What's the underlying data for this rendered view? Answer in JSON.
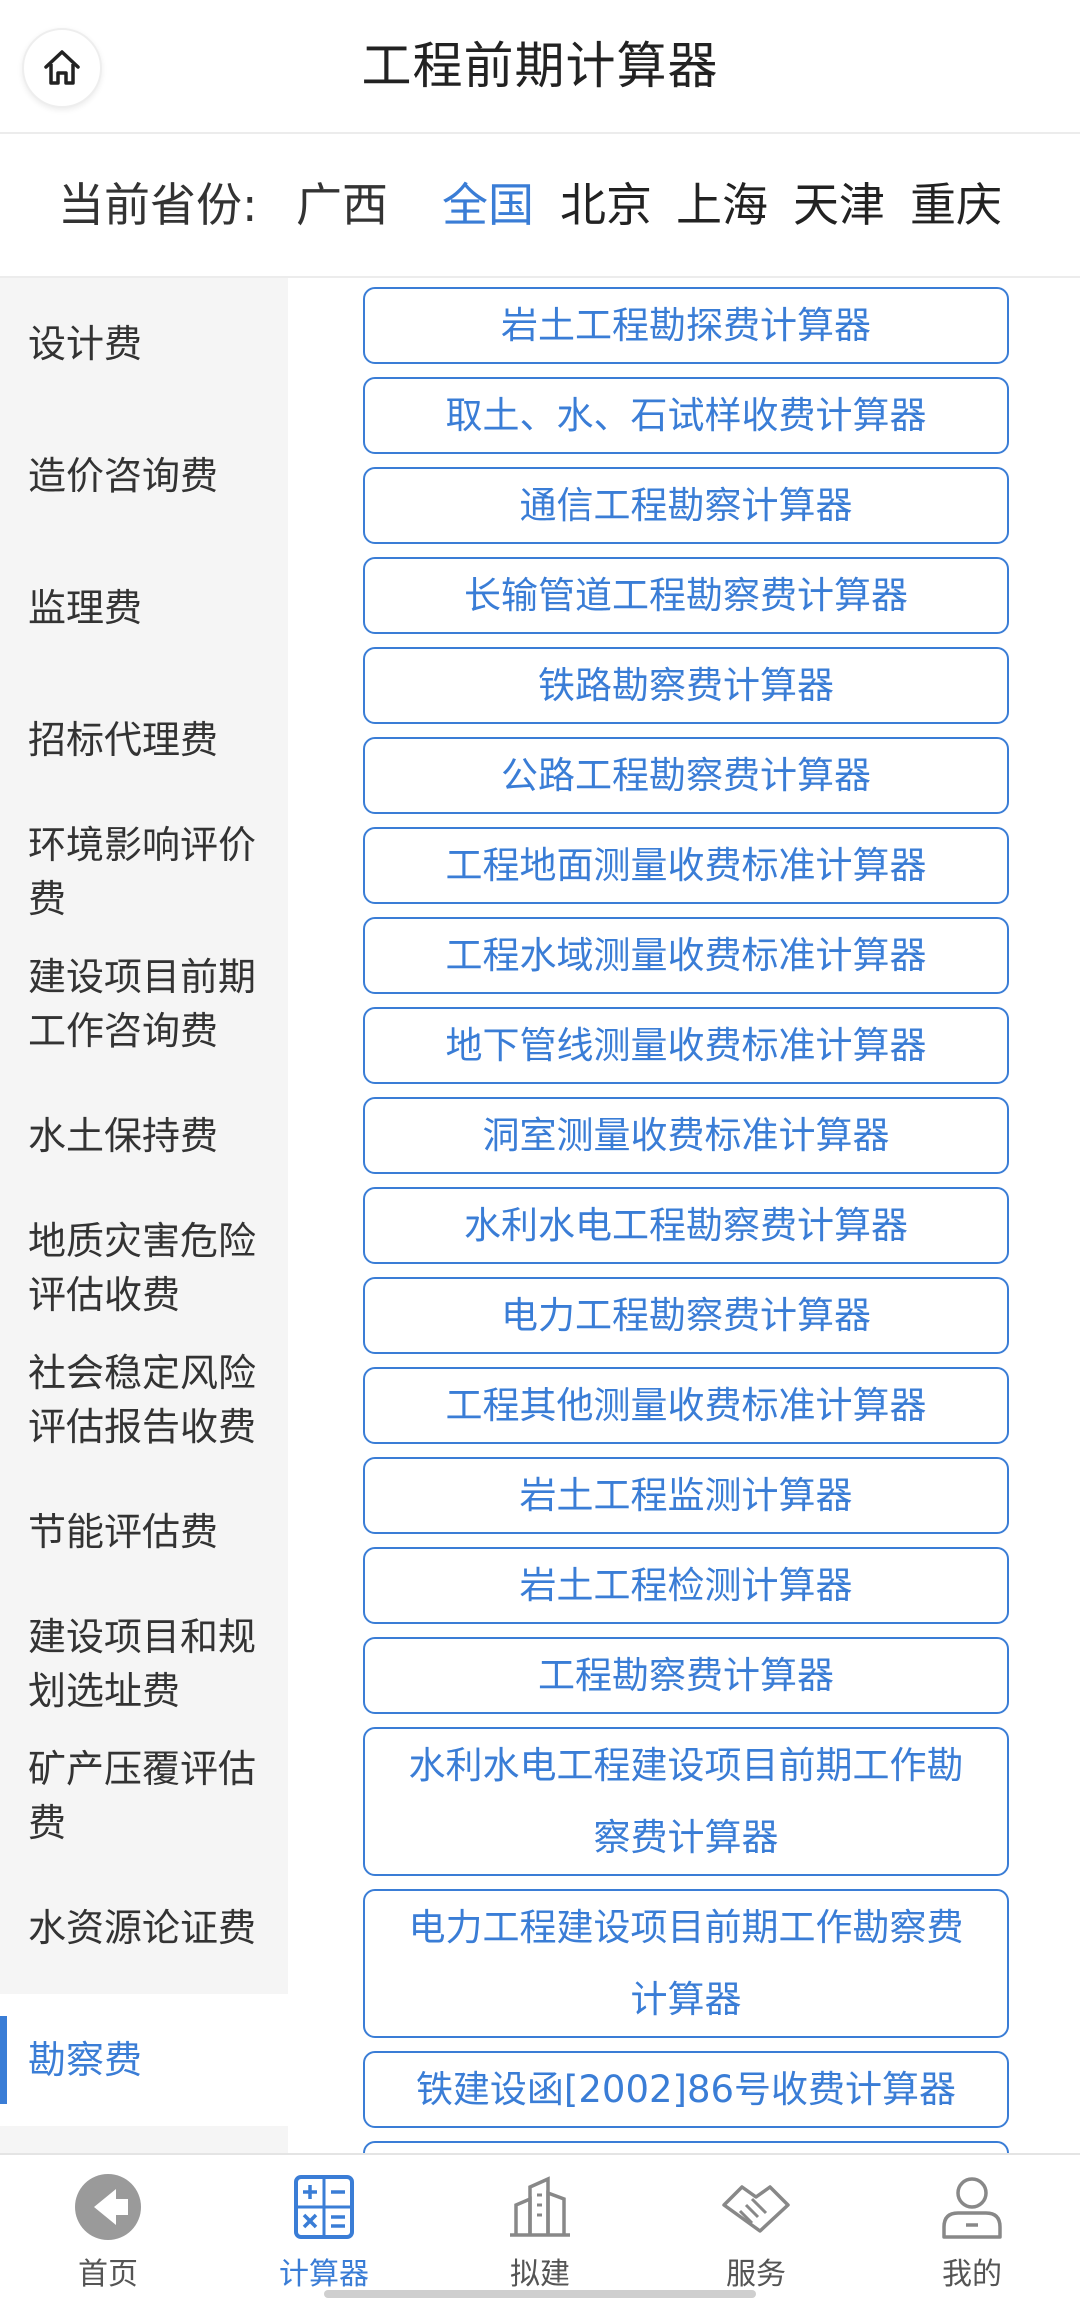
{
  "header": {
    "title": "工程前期计算器",
    "home_icon": "home-icon"
  },
  "province": {
    "label": "当前省份:",
    "current": "广西",
    "options": [
      "全国",
      "北京",
      "上海",
      "天津",
      "重庆"
    ],
    "active_index": 0
  },
  "sidebar": {
    "items": [
      {
        "label": "设计费"
      },
      {
        "label": "造价咨询费"
      },
      {
        "label": "监理费"
      },
      {
        "label": "招标代理费"
      },
      {
        "label": "环境影响评价费"
      },
      {
        "label": "建设项目前期工作咨询费"
      },
      {
        "label": "水土保持费"
      },
      {
        "label": "地质灾害危险评估收费"
      },
      {
        "label": "社会稳定风险评估报告收费"
      },
      {
        "label": "节能评估费"
      },
      {
        "label": "建设项目和规划选址费"
      },
      {
        "label": "矿产压覆评估费"
      },
      {
        "label": "水资源论证费"
      },
      {
        "label": "勘察费"
      }
    ],
    "active_index": 13
  },
  "calculators": [
    "岩土工程勘探费计算器",
    "取土、水、石试样收费计算器",
    "通信工程勘察计算器",
    "长输管道工程勘察费计算器",
    "铁路勘察费计算器",
    "公路工程勘察费计算器",
    "工程地面测量收费标准计算器",
    "工程水域测量收费标准计算器",
    "地下管线测量收费标准计算器",
    "洞室测量收费标准计算器",
    "水利水电工程勘察费计算器",
    "电力工程勘察费计算器",
    "工程其他测量收费标准计算器",
    "岩土工程监测计算器",
    "岩土工程检测计算器",
    "工程勘察费计算器",
    "水利水电工程建设项目前期工作勘察费计算器",
    "电力工程建设项目前期工作勘察费计算器",
    "铁建设函[2002]86号收费计算器"
  ],
  "bottom_nav": {
    "items": [
      {
        "label": "首页",
        "icon": "back-arrow-icon"
      },
      {
        "label": "计算器",
        "icon": "calculator-icon"
      },
      {
        "label": "拟建",
        "icon": "buildings-icon"
      },
      {
        "label": "服务",
        "icon": "handshake-icon"
      },
      {
        "label": "我的",
        "icon": "user-icon"
      }
    ],
    "active_index": 1
  },
  "colors": {
    "accent": "#3a7dd6",
    "sidebar_bg": "#f5f5f5",
    "text": "#333333"
  }
}
